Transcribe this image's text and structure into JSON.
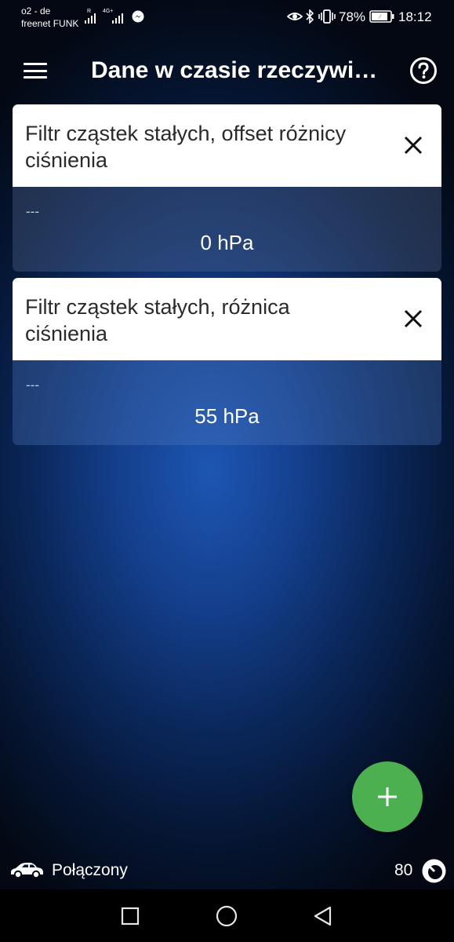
{
  "status_bar": {
    "carrier_line1": "o2 - de",
    "carrier_line2": "freenet FUNK",
    "net_label_1": "R",
    "net_label_2": "4G+",
    "battery_percent": "78%",
    "time": "18:12",
    "icons": [
      "signal-icon",
      "messenger-icon",
      "eye-icon",
      "bluetooth-icon",
      "vibrate-icon",
      "battery-icon"
    ]
  },
  "app_bar": {
    "title": "Dane w czasie rzeczywi…",
    "icons": [
      "menu-icon",
      "help-icon"
    ]
  },
  "cards": [
    {
      "title": "Filtr cząstek stałych, offset różnicy ciśnienia",
      "subtitle": "---",
      "value": "0 hPa"
    },
    {
      "title": "Filtr cząstek stałych, różnica ciśnienia",
      "subtitle": "---",
      "value": "55 hPa"
    }
  ],
  "fab": {
    "icon": "plus-icon",
    "color": "#4caf50"
  },
  "connection": {
    "icon": "car-icon",
    "label": "Połączony",
    "count": "80",
    "count_icon": "speed-icon"
  },
  "nav_bar": {
    "icons": [
      "recents-square-icon",
      "home-circle-icon",
      "back-triangle-icon"
    ]
  },
  "colors": {
    "background_center": "#1d56b3",
    "background_edge": "#030812",
    "card_header": "#ffffff",
    "fab": "#4caf50"
  }
}
